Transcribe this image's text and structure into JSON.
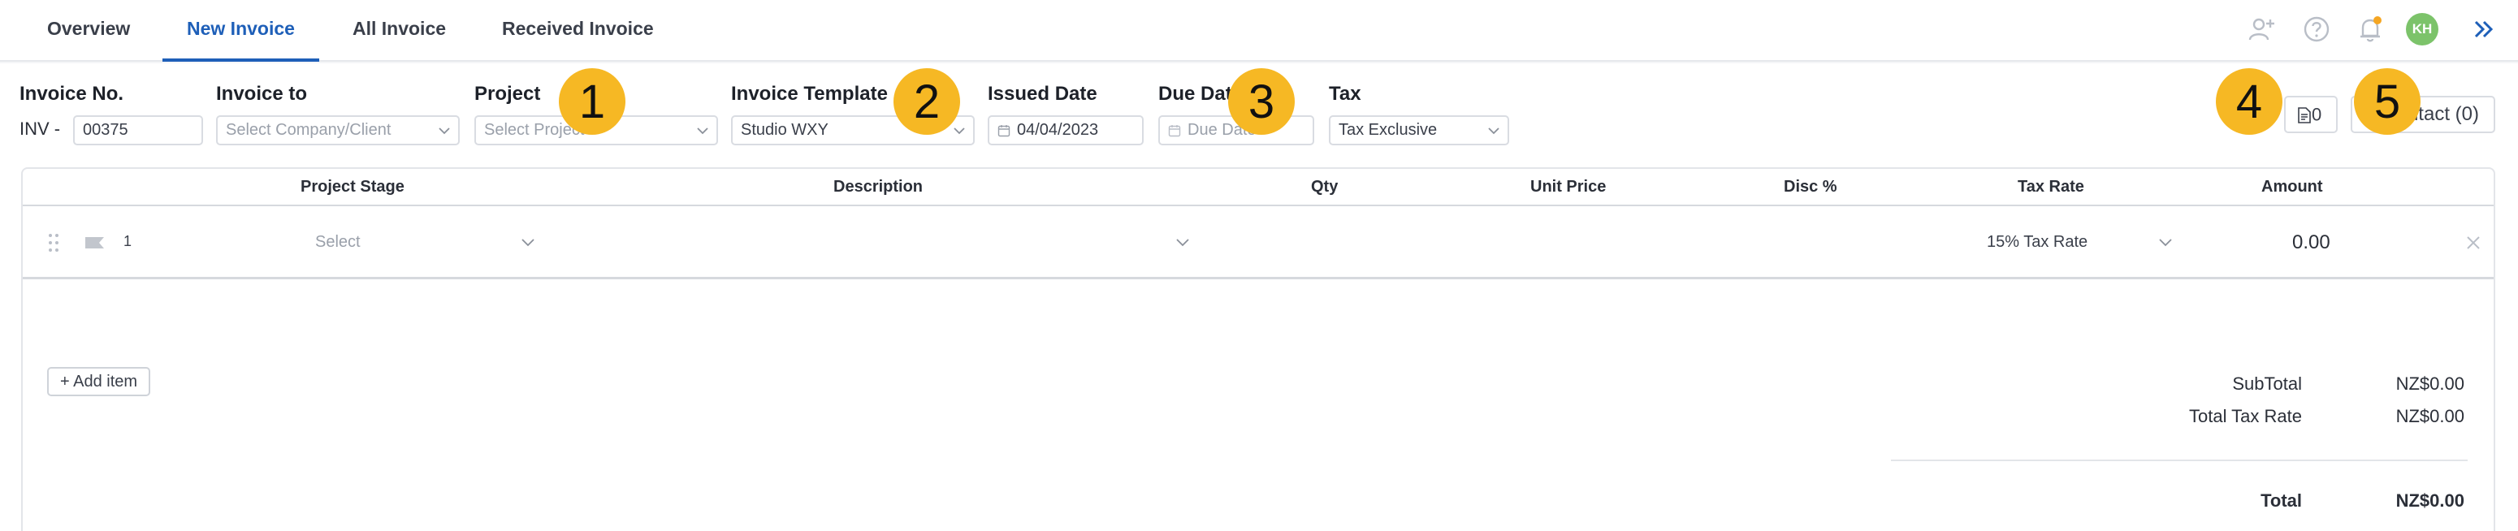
{
  "tabs": [
    {
      "label": "Overview",
      "active": false
    },
    {
      "label": "New Invoice",
      "active": true
    },
    {
      "label": "All Invoice",
      "active": false
    },
    {
      "label": "Received Invoice",
      "active": false
    }
  ],
  "header_icons": [
    "add-user-icon",
    "help-icon",
    "bell-icon",
    "avatar",
    "double-chevron-right-icon"
  ],
  "user": {
    "initials": "KH",
    "avatar_color": "#7cc36a",
    "notification_dot_color": "#f5a623"
  },
  "colors": {
    "accent": "#1e5fb8",
    "badge": "#f6b824"
  },
  "form": {
    "invoice_no": {
      "label": "Invoice No.",
      "prefix": "INV -",
      "value": "00375"
    },
    "invoice_to": {
      "label": "Invoice to",
      "placeholder": "Select Company/Client"
    },
    "project": {
      "label": "Project",
      "placeholder": "Select Project"
    },
    "invoice_template": {
      "label": "Invoice Template",
      "value": "Studio WXY"
    },
    "issued_date": {
      "label": "Issued Date",
      "value": "04/04/2023"
    },
    "due_date": {
      "label": "Due Date",
      "placeholder": "Due Date"
    },
    "tax": {
      "label": "Tax",
      "value": "Tax Exclusive"
    },
    "attachments_count": "0",
    "contact_button": "Contact (0)"
  },
  "badges": [
    "1",
    "2",
    "3",
    "4",
    "5"
  ],
  "table": {
    "headers": {
      "stage": "Project Stage",
      "description": "Description",
      "qty": "Qty",
      "unit_price": "Unit Price",
      "disc": "Disc %",
      "tax_rate": "Tax Rate",
      "amount": "Amount"
    },
    "rows": [
      {
        "index": "1",
        "stage": "Select",
        "description": "",
        "qty": "",
        "unit_price": "",
        "disc": "",
        "tax_rate": "15% Tax Rate",
        "amount": "0.00"
      }
    ]
  },
  "add_item_label": "+ Add item",
  "totals": {
    "subtotal_label": "SubTotal",
    "subtotal": "NZ$0.00",
    "tax_label": "Total Tax Rate",
    "tax": "NZ$0.00",
    "total_label": "Total",
    "total": "NZ$0.00"
  }
}
